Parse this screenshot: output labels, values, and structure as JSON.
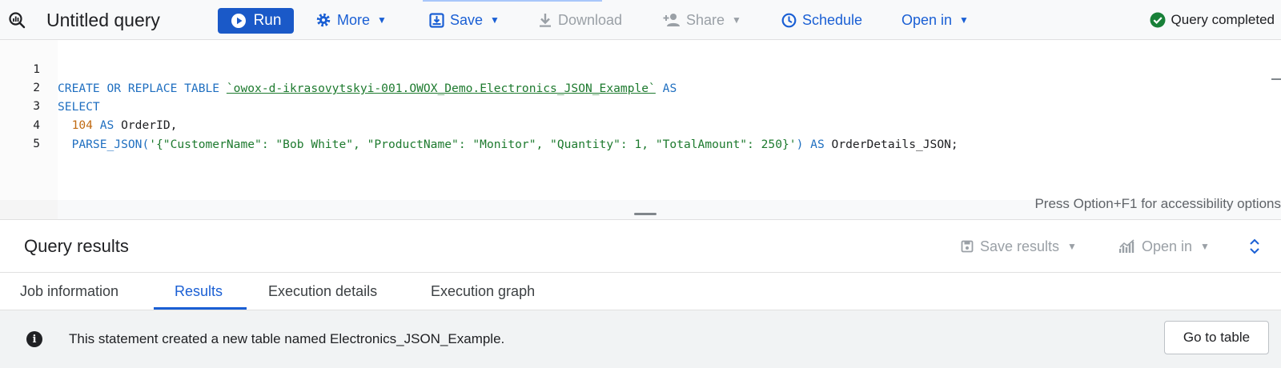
{
  "toolbar": {
    "title": "Untitled query",
    "run_label": "Run",
    "more_label": "More",
    "save_label": "Save",
    "download_label": "Download",
    "share_label": "Share",
    "schedule_label": "Schedule",
    "open_in_label": "Open in",
    "status": "Query completed"
  },
  "editor": {
    "line_numbers": [
      "1",
      "2",
      "3",
      "4",
      "5"
    ],
    "line1": {
      "create": "CREATE OR REPLACE TABLE",
      "table": "`owox-d-ikrasovytskyi-001.OWOX_Demo.Electronics_JSON_Example`",
      "as": "AS"
    },
    "line2": {
      "select": "SELECT"
    },
    "line3": {
      "number": "104",
      "as": "AS",
      "alias": "OrderID,"
    },
    "line4": {
      "func": "PARSE_JSON(",
      "string": "'{\"CustomerName\": \"Bob White\", \"ProductName\": \"Monitor\", \"Quantity\": 1, \"TotalAmount\": 250}'",
      "close": ")",
      "as": "AS",
      "alias": "OrderDetails_JSON;"
    },
    "accessibility_hint": "Press Option+F1 for accessibility options"
  },
  "results": {
    "title": "Query results",
    "save_results_label": "Save results",
    "open_in_label": "Open in",
    "tabs": [
      {
        "label": "Job information"
      },
      {
        "label": "Results",
        "active": true
      },
      {
        "label": "Execution details"
      },
      {
        "label": "Execution graph"
      }
    ],
    "message": "This statement created a new table named Electronics_JSON_Example.",
    "go_to_table_label": "Go to table"
  },
  "colors": {
    "accent": "#1a5fd4",
    "run_button": "#1a59c8",
    "success": "#188038",
    "keyword": "#1f6fc0",
    "string": "#1d7a2e",
    "number": "#c06a12"
  },
  "icons": {
    "logo": "query-search-icon",
    "run": "play-circle-icon",
    "more": "gear-icon",
    "save": "save-icon",
    "download": "download-icon",
    "share": "person-add-icon",
    "schedule": "clock-icon",
    "status": "check-circle-icon",
    "save_results": "save-icon",
    "open_in": "chart-icon",
    "expand": "unfold-icon",
    "info": "info-icon"
  }
}
